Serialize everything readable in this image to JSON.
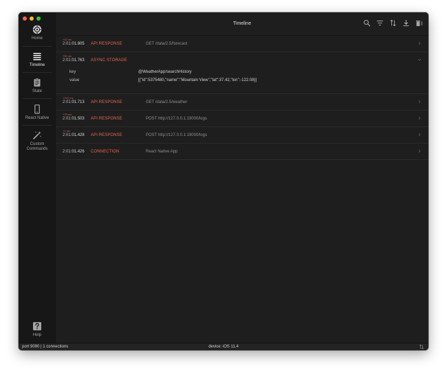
{
  "window": {
    "title": "Timeline"
  },
  "sidebar": {
    "items": [
      {
        "label": "Home",
        "icon": "reactotron-logo-icon"
      },
      {
        "label": "Timeline",
        "icon": "list-icon",
        "active": true
      },
      {
        "label": "State",
        "icon": "clipboard-icon"
      },
      {
        "label": "React Native",
        "icon": "phone-icon"
      },
      {
        "label": "Custom Commands",
        "icon": "magic-wand-icon"
      }
    ],
    "help_label": "Help"
  },
  "toolbar": {
    "icons": [
      "search-icon",
      "filter-icon",
      "sort-icon",
      "download-icon",
      "clear-icon"
    ]
  },
  "timeline": {
    "rows": [
      {
        "delta": "+42 ms",
        "time_prefix": "2:01:",
        "time_sec": "01.805",
        "tag": "API RESPONSE",
        "detail": "GET /data/2.5/forecast"
      },
      {
        "delta": "+50 ms",
        "time_prefix": "2:01:",
        "time_sec": "01.763",
        "tag": "ASYNC STORAGE",
        "detail": "",
        "key_label": "key",
        "key_value": "@WeatherApp/searchHistory",
        "value_label": "value",
        "value_value": "[{\"id\":5375480,\"name\":\"Mountain View\",\"lat\":37.42,\"lon\":-122.08}]"
      },
      {
        "delta": "+210 ms",
        "time_prefix": "2:01:",
        "time_sec": "01.713",
        "tag": "API RESPONSE",
        "detail": "GET /data/2.5/weather"
      },
      {
        "delta": "+75 ms",
        "time_prefix": "2:01:",
        "time_sec": "01.503",
        "tag": "API RESPONSE",
        "detail": "POST http://127.0.0.1:19000/logs"
      },
      {
        "delta": "+2 ms",
        "time_prefix": "2:01:",
        "time_sec": "01.428",
        "tag": "API RESPONSE",
        "detail": "POST http://127.0.0.1:19000/logs"
      },
      {
        "delta": "",
        "time_prefix": "2:01:",
        "time_sec": "01.426",
        "tag": "CONNECTION",
        "detail": "React Native App"
      }
    ]
  },
  "statusbar": {
    "left": "port 9090 | 1 connections",
    "center": "device: iOS 11.4"
  },
  "colors": {
    "accent": "#e0684c",
    "delta": "#d0605b",
    "background": "#1e1e1e",
    "sidebar": "#171717"
  }
}
